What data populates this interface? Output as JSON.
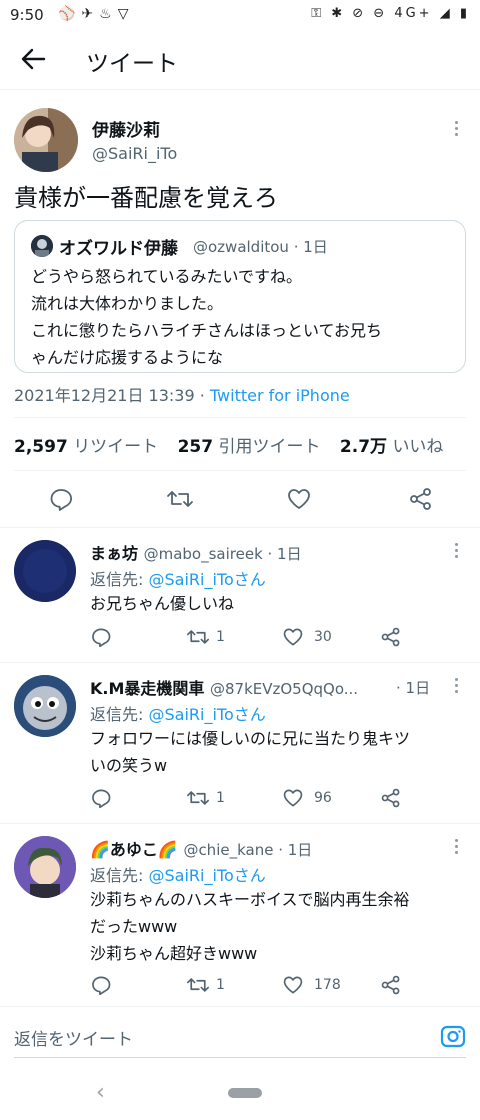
{
  "status_bar": {
    "time": "9:50",
    "network": "4G+"
  },
  "header": {
    "title": "ツイート"
  },
  "tweet": {
    "author_name": "伊藤沙莉",
    "author_handle": "@SaiRi_iTo",
    "text": "貴様が一番配慮を覚えろ",
    "quote": {
      "name": "オズワルド伊藤",
      "handle_time": "@ozwalditou · 1日",
      "lines": [
        "どうやら怒られているみたいですね。",
        "流れは大体わかりました。",
        "これに懲りたらハライチさんはほっといてお兄ち",
        "ゃんだけ応援するようにな"
      ]
    },
    "timestamp": "2021年12月21日 13:39 · ",
    "source": "Twitter for iPhone",
    "retweets_count": "2,597",
    "retweets_label": "リツイート",
    "quotes_count": "257",
    "quotes_label": "引用ツイート",
    "likes_count": "2.7万",
    "likes_label": "いいね"
  },
  "replies": [
    {
      "name": "まぁ坊",
      "handle_time": "@mabo_saireek · 1日",
      "reply_prefix": "返信先: ",
      "mention": "@SaiRi_iToさん",
      "lines": [
        "お兄ちゃん優しいね"
      ],
      "retweets": "1",
      "likes": "30"
    },
    {
      "name": "K.M暴走機関車",
      "handle_time": "@87kEVzO5QqQo...",
      "time": "· 1日",
      "reply_prefix": "返信先: ",
      "mention": "@SaiRi_iToさん",
      "lines": [
        "フォロワーには優しいのに兄に当たり鬼キツ",
        "いの笑うw"
      ],
      "retweets": "1",
      "likes": "96"
    },
    {
      "name": "🌈あゆこ🌈",
      "handle_time": "@chie_kane · 1日",
      "reply_prefix": "返信先: ",
      "mention": "@SaiRi_iToさん",
      "lines": [
        "沙莉ちゃんのハスキーボイスで脳内再生余裕",
        "だったwww",
        "沙莉ちゃん超好きwww"
      ],
      "retweets": "1",
      "likes": "178"
    }
  ],
  "compose": {
    "placeholder": "返信をツイート"
  },
  "colors": {
    "accent": "#1d9bf0",
    "secondary_text": "#536471",
    "divider": "#eff3f4"
  }
}
